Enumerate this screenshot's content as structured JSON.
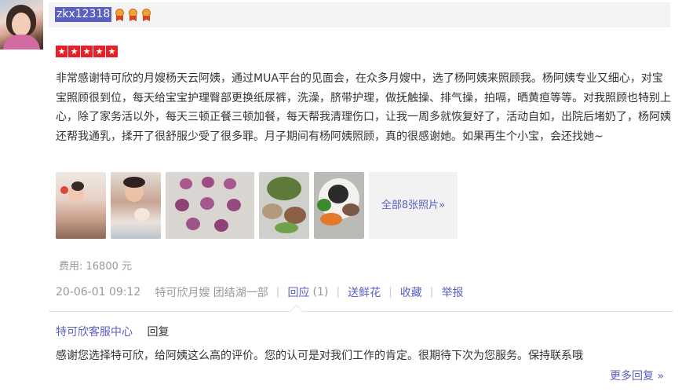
{
  "user": {
    "name": "zkx12318",
    "medal_count": 3,
    "rating": 5,
    "star_glyph": "★"
  },
  "review": {
    "text": "非常感谢特可欣的月嫂杨天云阿姨，通过MUA平台的见面会，在众多月嫂中，选了杨阿姨来照顾我。杨阿姨专业又细心，对宝宝照顾很到位，每天给宝宝护理臀部更换纸尿裤，洗澡，脐带护理，做抚触操、排气操，拍嗝，晒黄疸等等。对我照顾也特别上心，除了家务活以外，每天三顿正餐三顿加餐，每天帮我清理伤口，让我一周多就恢复好了，活动自如，出院后堵奶了，杨阿姨还帮我通乳，揉开了很舒服少受了很多罪。月子期间有杨阿姨照顾，真的很感谢她。如果再生个小宝，会还找她~",
    "all_photos": "全部8张照片»",
    "fee": "费用: 16800 元"
  },
  "meta": {
    "datetime": "20-06-01 09:12",
    "shop": "特可欣月嫂 团结湖一部",
    "reply": "回应",
    "reply_count": "(1)",
    "flower": "送鲜花",
    "favorite": "收藏",
    "report": "举报",
    "separator": "|"
  },
  "reply": {
    "from": "特可欣客服中心",
    "label": "回复",
    "text": "感谢您选择特可欣，给阿姨这么高的评价。您的认可是对我们工作的肯定。很期待下次为您服务。保持联系哦",
    "more": "更多回复 »"
  },
  "colors": {
    "accent": "#5b5fc0",
    "star": "#e4212b",
    "muted": "#999999"
  }
}
